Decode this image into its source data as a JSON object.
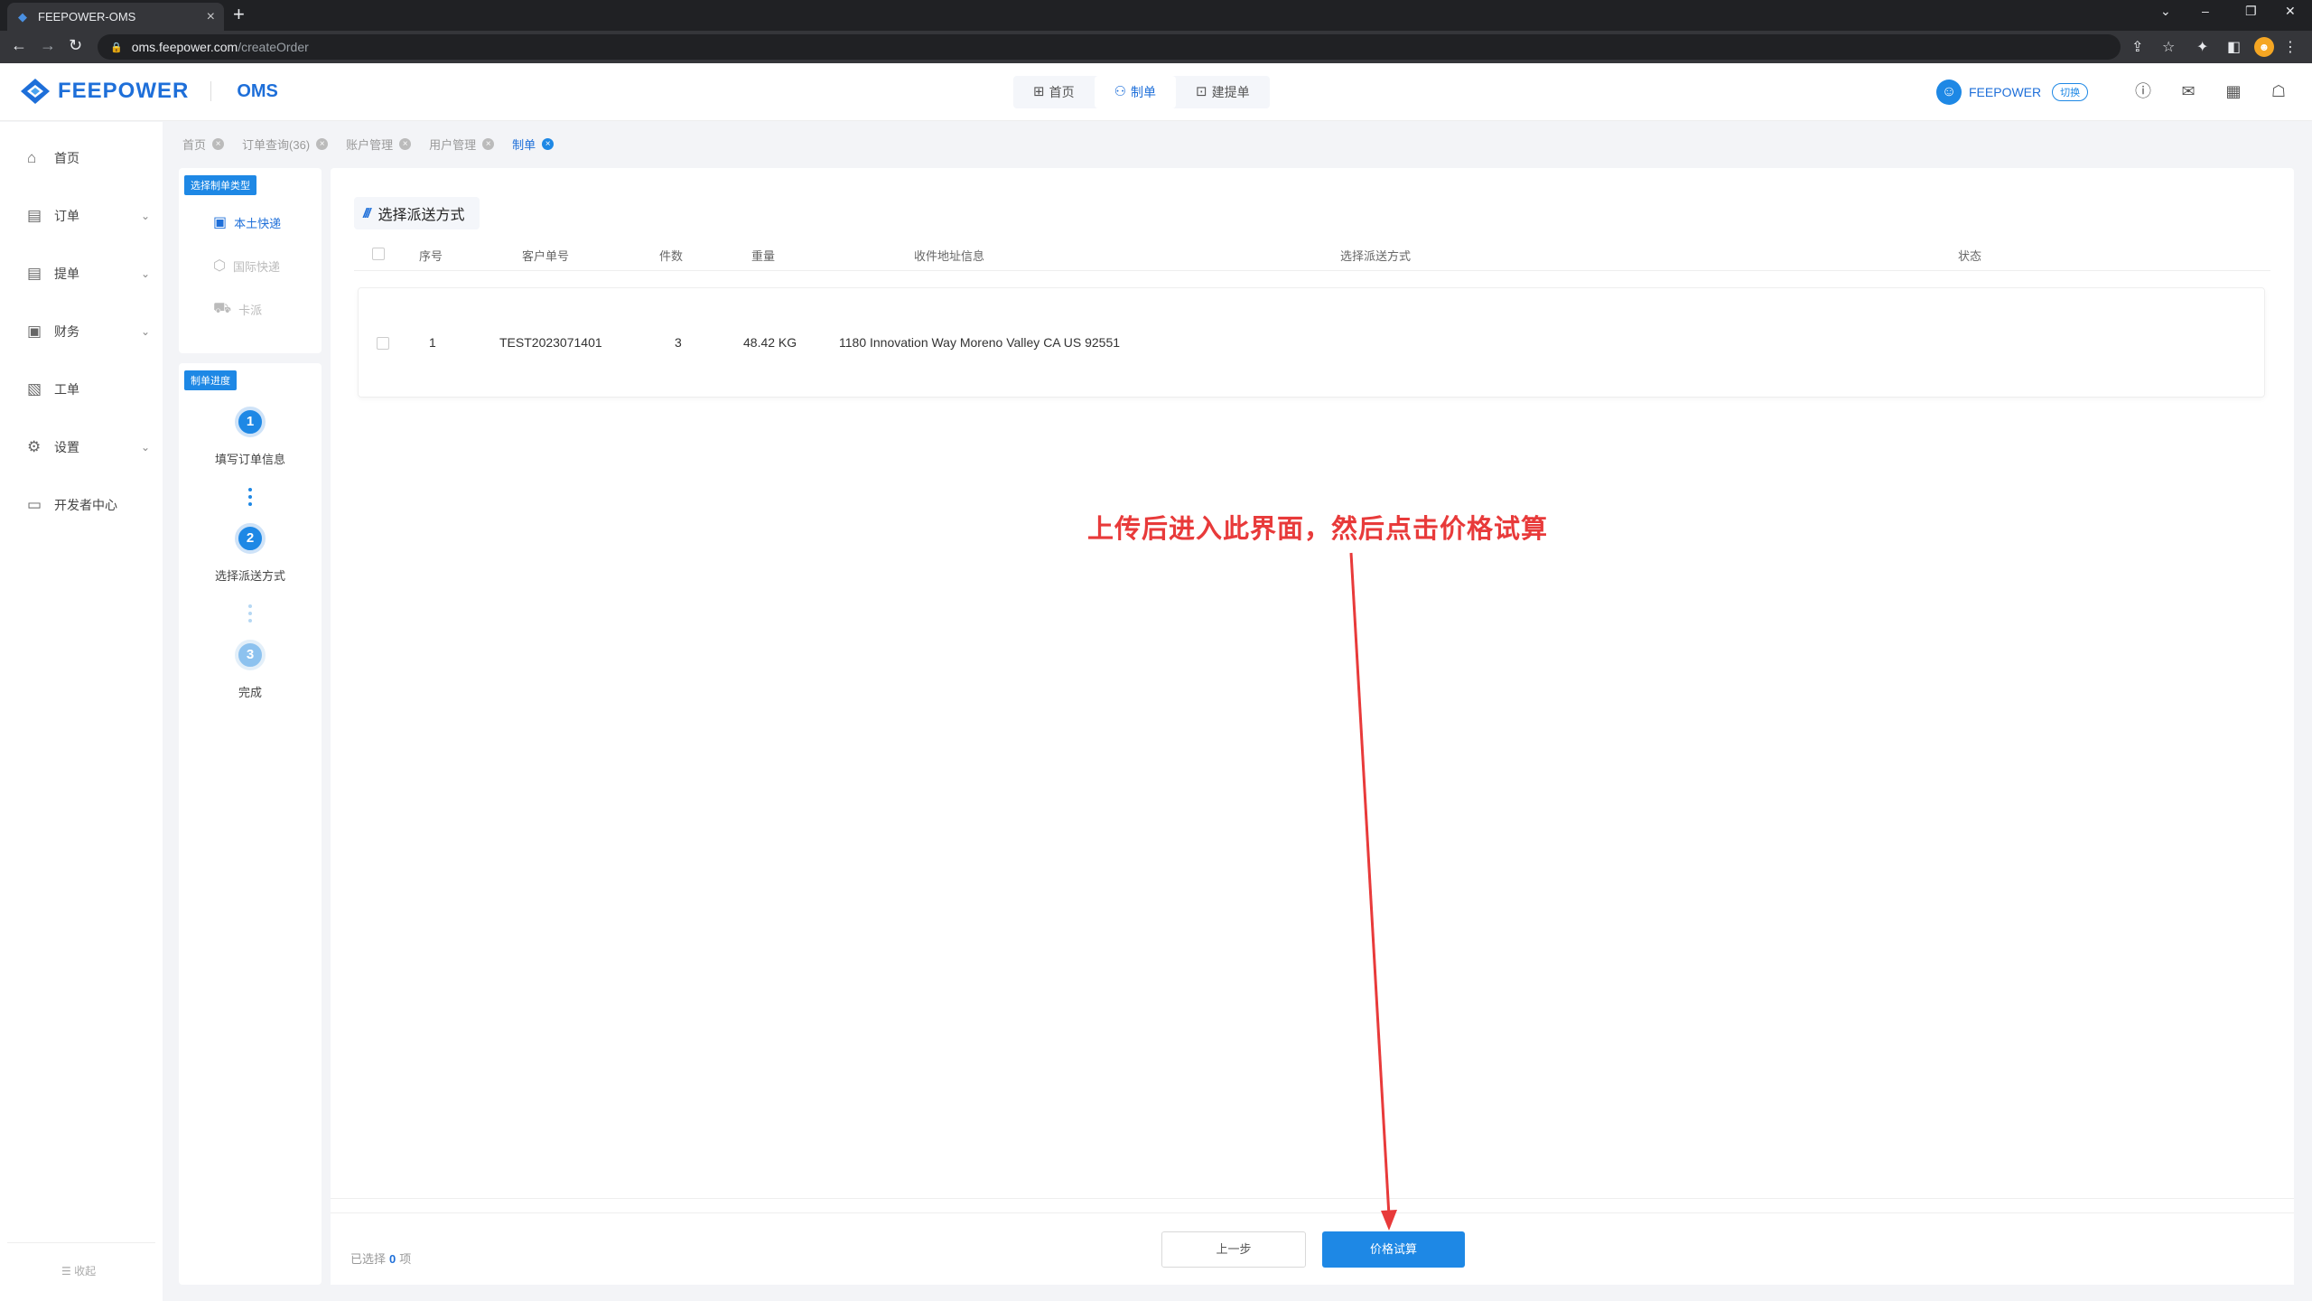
{
  "browser": {
    "tab_title": "FEEPOWER-OMS",
    "url_host": "oms.feepower.com",
    "url_path": "/createOrder"
  },
  "header": {
    "brand": "FEEPOWER",
    "product": "OMS",
    "nav": [
      {
        "label": "首页",
        "icon": "grid-icon"
      },
      {
        "label": "制单",
        "icon": "user-doc-icon"
      },
      {
        "label": "建提单",
        "icon": "new-doc-icon"
      }
    ],
    "user_name": "FEEPOWER",
    "switch_label": "切换"
  },
  "sidebar": {
    "items": [
      {
        "label": "首页",
        "icon": "home-icon"
      },
      {
        "label": "订单",
        "icon": "order-icon"
      },
      {
        "label": "提单",
        "icon": "bill-icon"
      },
      {
        "label": "财务",
        "icon": "finance-icon"
      },
      {
        "label": "工单",
        "icon": "ticket-icon"
      },
      {
        "label": "设置",
        "icon": "settings-icon"
      },
      {
        "label": "开发者中心",
        "icon": "developer-icon"
      }
    ],
    "collapse_label": "收起"
  },
  "page_tabs": [
    {
      "label": "首页"
    },
    {
      "label": "订单查询(36)"
    },
    {
      "label": "账户管理"
    },
    {
      "label": "用户管理"
    },
    {
      "label": "制单"
    }
  ],
  "order_type": {
    "tag": "选择制单类型",
    "options": [
      {
        "label": "本土快递"
      },
      {
        "label": "国际快递"
      },
      {
        "label": "卡派"
      }
    ]
  },
  "progress": {
    "tag": "制单进度",
    "steps": [
      {
        "num": "1",
        "label": "填写订单信息"
      },
      {
        "num": "2",
        "label": "选择派送方式"
      },
      {
        "num": "3",
        "label": "完成"
      }
    ]
  },
  "section": {
    "title": "选择派送方式",
    "columns": [
      "序号",
      "客户单号",
      "件数",
      "重量",
      "收件地址信息",
      "选择派送方式",
      "状态"
    ],
    "rows": [
      {
        "index": "1",
        "customer_no": "TEST2023071401",
        "pieces": "3",
        "weight": "48.42 KG",
        "address": "1180 Innovation Way Moreno Valley CA US 92551",
        "method": "",
        "status": ""
      }
    ]
  },
  "footer": {
    "selected_prefix": "已选择",
    "selected_count": "0",
    "selected_suffix": "项",
    "prev_label": "上一步",
    "calc_label": "价格试算"
  },
  "annotation": {
    "text": "上传后进入此界面，然后点击价格试算",
    "color": "#e83a3a"
  },
  "colors": {
    "accent": "#1e88e5",
    "brand": "#1e6fd9"
  }
}
